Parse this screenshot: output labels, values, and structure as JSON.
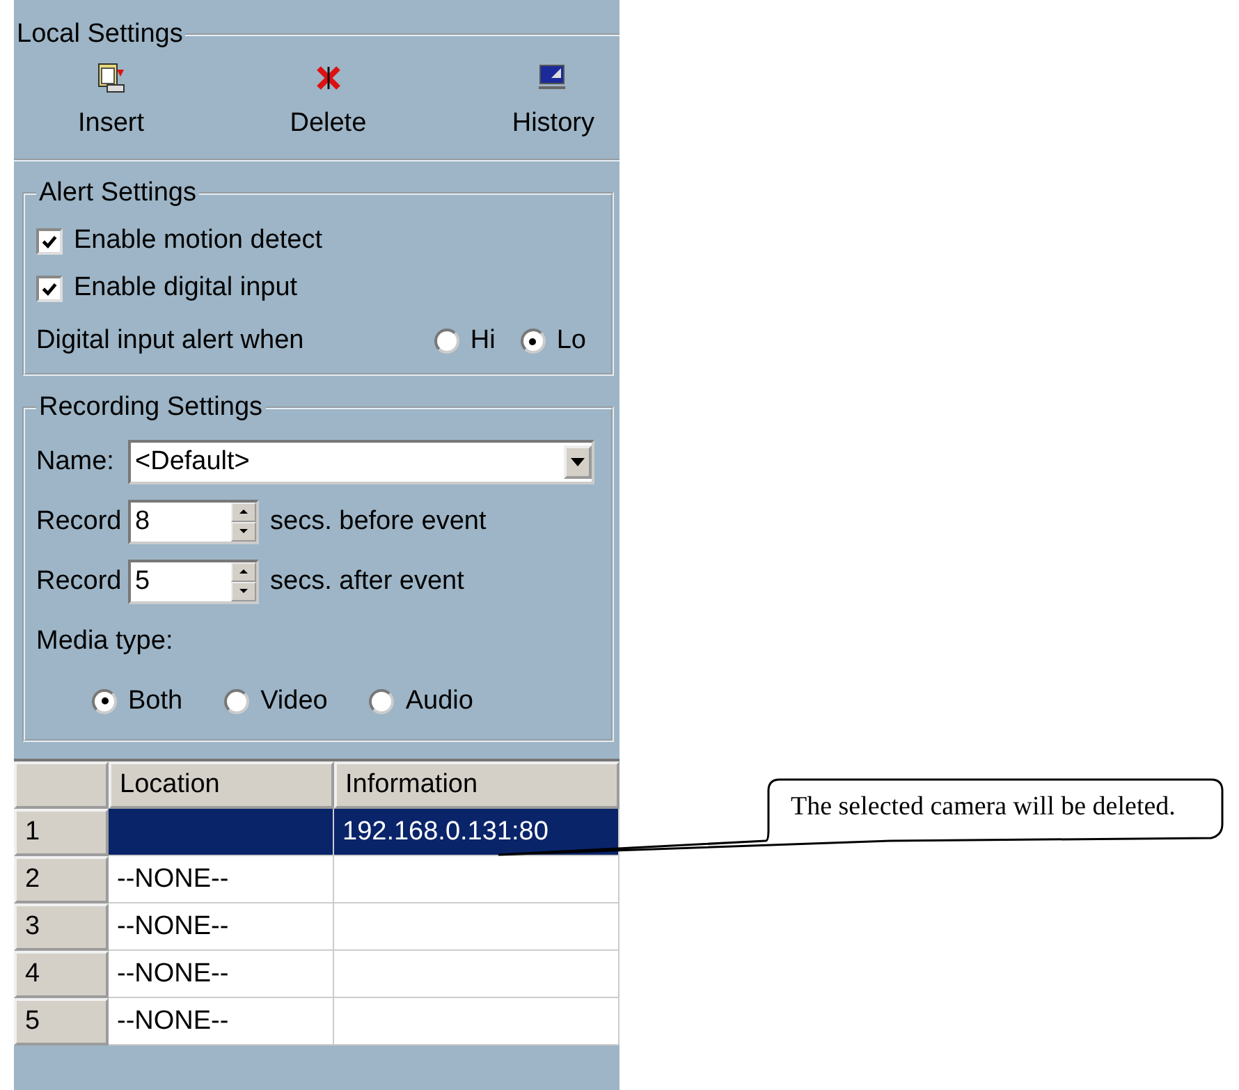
{
  "local_settings": {
    "title": "Local Settings",
    "tools": [
      {
        "label": "Insert",
        "kind": "insert"
      },
      {
        "label": "Delete",
        "kind": "delete"
      },
      {
        "label": "History",
        "kind": "history"
      }
    ]
  },
  "alert_settings": {
    "title": "Alert Settings",
    "checkboxes": [
      {
        "label": "Enable motion detect",
        "checked": true
      },
      {
        "label": "Enable digital input",
        "checked": true
      }
    ],
    "alert_label": "Digital input alert when",
    "alert_options": [
      {
        "label": "Hi",
        "selected": false
      },
      {
        "label": "Lo",
        "selected": true
      }
    ]
  },
  "recording_settings": {
    "title": "Recording Settings",
    "name_label": "Name:",
    "name_value": "<Default>",
    "records": [
      {
        "label": "Record",
        "value": "8",
        "suffix": "secs. before event"
      },
      {
        "label": "Record",
        "value": "5",
        "suffix": "secs. after event"
      }
    ],
    "media_label": "Media type:",
    "media_options": [
      {
        "label": "Both",
        "selected": true
      },
      {
        "label": "Video",
        "selected": false
      },
      {
        "label": "Audio",
        "selected": false
      }
    ]
  },
  "table": {
    "columns": [
      "Location",
      "Information"
    ],
    "rows": [
      {
        "number": "1",
        "information": "192.168.0.131:80",
        "selected": true
      },
      {
        "number": "2",
        "location": "--NONE--",
        "selected": false
      },
      {
        "number": "3",
        "location": "--NONE--",
        "selected": false
      },
      {
        "number": "4",
        "location": "--NONE--",
        "selected": false
      },
      {
        "number": "5",
        "location": "--NONE--",
        "selected": false
      }
    ]
  },
  "callout": {
    "text": "The selected camera will be deleted."
  }
}
